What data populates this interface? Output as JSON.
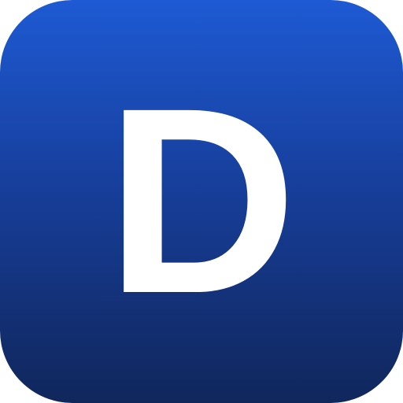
{
  "app_icon": {
    "letter": "D",
    "gradient_top_color": "#1e5ad4",
    "gradient_bottom_color": "#10275c",
    "letter_color": "#ffffff"
  }
}
